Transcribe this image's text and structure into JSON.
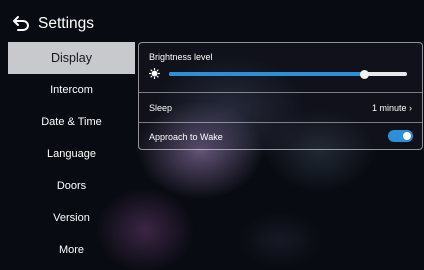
{
  "header": {
    "title": "Settings",
    "back_icon": "back-arrow-icon"
  },
  "sidebar": {
    "items": [
      {
        "label": "Display",
        "active": true
      },
      {
        "label": "Intercom",
        "active": false
      },
      {
        "label": "Date & Time",
        "active": false
      },
      {
        "label": "Language",
        "active": false
      },
      {
        "label": "Doors",
        "active": false
      },
      {
        "label": "Version",
        "active": false
      },
      {
        "label": "More",
        "active": false
      }
    ]
  },
  "display": {
    "brightness": {
      "label": "Brightness level",
      "icon": "brightness-icon",
      "value": 0.82
    },
    "sleep": {
      "label": "Sleep",
      "value": "1 minute",
      "chevron": "›"
    },
    "approach_to_wake": {
      "label": "Approach to Wake",
      "enabled": true
    }
  },
  "colors": {
    "accent": "#2f8fd6",
    "active_tab_bg": "#c7c9cd",
    "background": "#090b12"
  }
}
